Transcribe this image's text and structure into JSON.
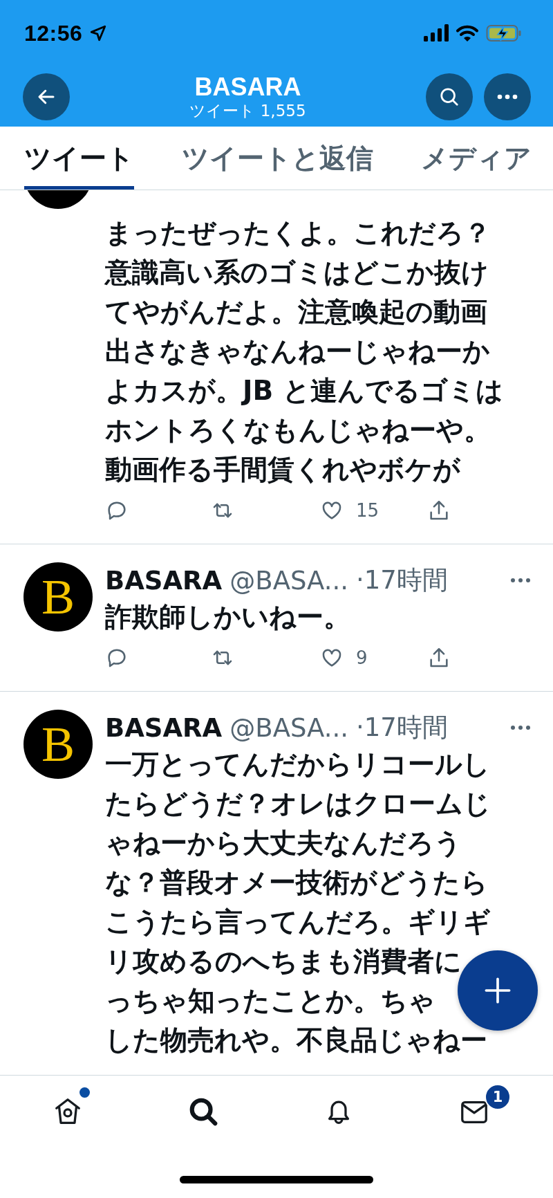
{
  "status_bar": {
    "time": "12:56"
  },
  "header": {
    "title": "BASARA",
    "subtitle": "ツイート 1,555"
  },
  "tabs": [
    {
      "label": "ツイート",
      "selected": true
    },
    {
      "label": "ツイートと返信",
      "selected": false
    },
    {
      "label": "メディア",
      "selected": false
    }
  ],
  "tweets": [
    {
      "lines": [
        "まったぜったくよ。これだろ？",
        "意識高い系のゴミはどこか抜け",
        "てやがんだよ。注意喚起の動画",
        "出さなきゃなんねーじゃねーか",
        "よカスが。JB と連んでるゴミは",
        "ホントろくなもんじゃねーや。",
        "動画作る手間賃くれやボケが"
      ],
      "actions": {
        "like_count": "15"
      }
    },
    {
      "author": "BASARA",
      "handle": "@BASA...",
      "time": "·17時間",
      "avatar_letter": "B",
      "lines": [
        "詐欺師しかいねー。"
      ],
      "actions": {
        "like_count": "9"
      }
    },
    {
      "author": "BASARA",
      "handle": "@BASA...",
      "time": "·17時間",
      "avatar_letter": "B",
      "lines": [
        "一万とってんだからリコールし",
        "たらどうだ？オレはクロームじ",
        "ゃねーから大丈夫なんだろう",
        "な？普段オメー技術がどうたら",
        "こうたら言ってんだろ。ギリギ",
        "リ攻めるのへちまも消費者に",
        "っちゃ知ったことか。ちゃ",
        "した物売れや。不良品じゃねー"
      ]
    }
  ],
  "nav": [
    {
      "kind": "home",
      "selected": false,
      "dot": true
    },
    {
      "kind": "search",
      "selected": true,
      "dot": false
    },
    {
      "kind": "notifications",
      "selected": false,
      "dot": false
    },
    {
      "kind": "messages",
      "selected": false,
      "dot": false,
      "badge": "1"
    }
  ]
}
